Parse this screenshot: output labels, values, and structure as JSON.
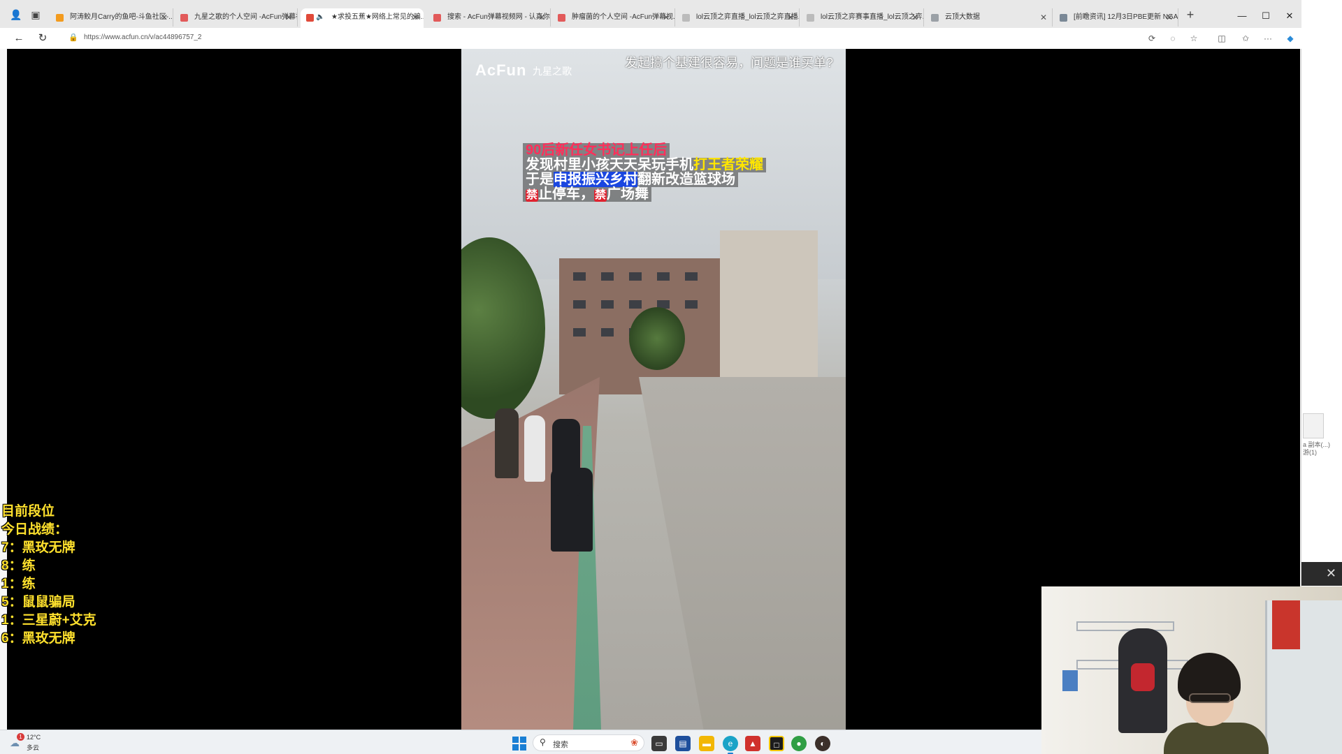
{
  "browser": {
    "tabs": [
      {
        "title": "阿涛鲛月Carry的鱼吧-斗鱼社区-...",
        "favicon_color": "#f39b1e",
        "active": false
      },
      {
        "title": "九星之歌的个人空间 -AcFun弹幕视...",
        "favicon_color": "#e25a5a",
        "active": false
      },
      {
        "title": "★求投五蕉★网络上常见的骗...",
        "favicon_color": "#e04a3a",
        "active": true,
        "audio": true
      },
      {
        "title": "搜索 - AcFun弹幕视频网 - 认真你...",
        "favicon_color": "#e25a5a",
        "active": false
      },
      {
        "title": "肿瘤菌的个人空间 -AcFun弹幕视...",
        "favicon_color": "#e25a5a",
        "active": false
      },
      {
        "title": "lol云顶之弈直播_lol云顶之弈直播...",
        "favicon_color": "#bbbbbb",
        "active": false
      },
      {
        "title": "lol云顶之弈赛事直播_lol云顶之弈...",
        "favicon_color": "#bbbbbb",
        "active": false
      },
      {
        "title": "云顶大数据",
        "favicon_color": "#9aa0a6",
        "active": false
      },
      {
        "title": "[前瞻资讯] 12月3日PBE更新 NGA...",
        "favicon_color": "#7a8896",
        "active": false
      }
    ],
    "new_tab_label": "+",
    "window_controls": {
      "minimize": "—",
      "maximize": "☐",
      "close": "✕"
    },
    "url": "https://www.acfun.cn/v/ac44896757_2",
    "nav": {
      "back": "←",
      "reload": "↻"
    }
  },
  "video": {
    "logo_text": "AcFun",
    "channel_name": "九星之歌",
    "top_caption": "发起搞个基建很容易，问题是谁买单?",
    "caption": {
      "line1": "90后新任女书记上任后",
      "line2_a": "发现村里小孩天天呆玩手机",
      "line2_b": "打王者荣耀",
      "line3_a": "于是",
      "line3_b": "申报振兴乡村",
      "line3_c": "翻新改造篮球场",
      "line4_ban1": "禁",
      "line4_a": "止停车，",
      "line4_ban2": "禁",
      "line4_b": "广场舞"
    }
  },
  "rank_panel": {
    "title": "目前段位",
    "subtitle": "今日战绩：",
    "results": [
      "7：黑玫无牌",
      "8：练",
      "1：练",
      "5：鼠鼠骗局",
      "1：三星蔚+艾克",
      "6：黑玫无牌"
    ]
  },
  "desktop": {
    "file_label": "a 副本(...)\n游(1)"
  },
  "webcam": {
    "close_label": "✕"
  },
  "taskbar": {
    "weather_temp": "12°C",
    "weather_desc": "多云",
    "weather_badge": "1",
    "search_placeholder": "搜索",
    "apps": [
      {
        "name": "task-view",
        "color": "#3a3a3a"
      },
      {
        "name": "store",
        "color": "#1e4f9c"
      },
      {
        "name": "file-explorer",
        "color": "#f2b705"
      },
      {
        "name": "edge",
        "color": "#1aa3c7"
      },
      {
        "name": "game-app",
        "color": "#d0312d"
      },
      {
        "name": "app-yellow-black",
        "color": "#1c1c1c"
      },
      {
        "name": "chrome",
        "color": "#2f9e44"
      },
      {
        "name": "app-dark",
        "color": "#3b2f2a"
      }
    ]
  },
  "colors": {
    "rank_text": "#ffe12d",
    "caption_red": "#ff2f5a",
    "caption_yellow": "#ffe600",
    "caption_blue_bg": "#1a46e0",
    "accent": "#1a7fd4"
  }
}
